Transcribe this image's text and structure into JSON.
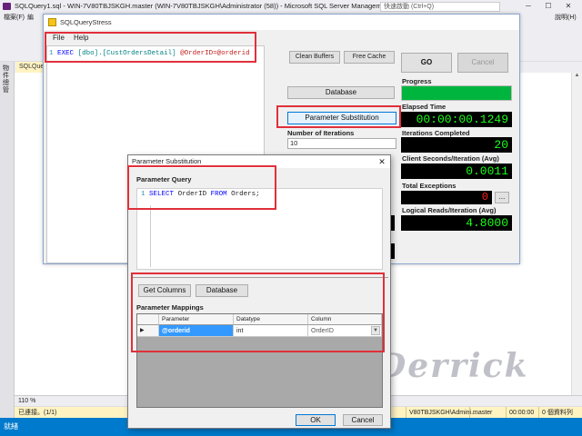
{
  "ssms": {
    "title": "SQLQuery1.sql - WIN-7V80TBJSKGH.master (WIN-7V80TBJSKGH\\Administrator (58)) - Microsoft SQL Server Managem...",
    "quick_launch": "快速啟動 (Ctrl+Q)",
    "menu": [
      "檔案(F)",
      "編"
    ],
    "menu_right": "說明(H)",
    "left_rail_text": "物件總管",
    "doc_tab": "SQLQue",
    "zoom": "110 %",
    "connection": "已連接。(1/1)",
    "conn_server": "V80TBJSKGH\\Admini...",
    "conn_db": "master",
    "conn_time": "00:00:00",
    "conn_rows": "0 個資料列",
    "status": "就緒"
  },
  "qs": {
    "title": "SQLQueryStress",
    "menu": [
      "File",
      "Help"
    ],
    "editor": {
      "line_no": "1",
      "kw_exec": "EXEC",
      "obj": "[dbo].[CustOrdersDetail]",
      "param": "@OrderID=@orderid"
    },
    "buttons": {
      "clean_buffers": "Clean Buffers",
      "free_cache": "Free Cache",
      "go": "GO",
      "cancel": "Cancel",
      "database": "Database",
      "param_subst": "Parameter Substitution"
    },
    "labels": {
      "iterations": "Number of Iterations",
      "progress": "Progress",
      "elapsed": "Elapsed Time",
      "iter_completed": "Iterations Completed",
      "client_sec": "Client Seconds/Iteration (Avg)",
      "total_exc": "Total Exceptions",
      "logical_reads": "Logical Reads/Iteration (Avg)"
    },
    "iterations_value": "10",
    "progress_fraction": 1,
    "elapsed_value": "00:00:00.1249",
    "iter_completed_value": "20",
    "client_sec_value": "0.0011",
    "total_exc_value": "0",
    "logical_reads_value": "4.8000",
    "exc_detail_button": "..."
  },
  "watermark": "Derrick",
  "dialog": {
    "title": "Parameter Substitution",
    "close": "✕",
    "param_query_label": "Parameter Query",
    "query": {
      "line_no": "1",
      "select": "SELECT",
      "col": "OrderID",
      "from": "FROM",
      "table": "Orders;"
    },
    "get_columns": "Get Columns",
    "database": "Database",
    "mappings_label": "Parameter Mappings",
    "grid": {
      "headers": [
        "Parameter",
        "Datatype",
        "Column"
      ],
      "row": {
        "parameter": "@orderid",
        "datatype": "int",
        "column": "OrderID"
      }
    },
    "ok": "OK",
    "cancel": "Cancel"
  },
  "colors": {
    "highlight": "#e0303a",
    "led_green": "#1aff1a",
    "led_red": "#ff2020",
    "progress_fill": "#00b53d",
    "status_blue": "#007acc",
    "selection_blue": "#3399ff"
  }
}
